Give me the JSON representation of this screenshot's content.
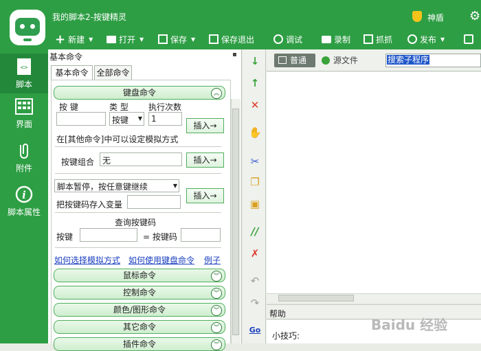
{
  "window": {
    "title": "我的脚本2-按键精灵",
    "vip_label": "神盾"
  },
  "toolbar": {
    "new": "新建",
    "open": "打开",
    "save": "保存",
    "save_exit": "保存退出",
    "debug": "调试",
    "record": "录制",
    "capture": "抓抓",
    "publish": "发布"
  },
  "sidebar": {
    "items": [
      {
        "label": "脚本",
        "icon": "script-icon"
      },
      {
        "label": "界面",
        "icon": "interface-icon"
      },
      {
        "label": "附件",
        "icon": "attachment-icon"
      },
      {
        "label": "脚本属性",
        "icon": "info-icon"
      }
    ]
  },
  "panel": {
    "title": "基本命令",
    "tabs": {
      "basic": "基本命令",
      "all": "全部命令"
    },
    "keyboard": {
      "header": "键盘命令",
      "key_label": "按 键",
      "type_label": "类 型",
      "count_label": "执行次数",
      "type_value": "按键",
      "count_value": "1",
      "insert": "插入→",
      "hint": "在[其他命令]中可以设定模拟方式",
      "combo_label": "按键组合",
      "combo_value": "无",
      "pause_select": "脚本暂停，按任意键继续",
      "store_label": "把按键码存入变量",
      "query_title": "查询按键码",
      "query_key_label": "按键",
      "query_code_label": "= 按键码",
      "link_simulation": "如何选择模拟方式",
      "link_usage": "如何使用键盘命令",
      "link_example": "例子"
    },
    "groups": [
      "鼠标命令",
      "控制命令",
      "颜色/图形命令",
      "其它命令",
      "插件命令"
    ]
  },
  "editor": {
    "normal_tab": "普通",
    "source_tab": "源文件",
    "search_placeholder": "搜索子程序",
    "help_label": "帮助",
    "tip_label": "小技巧:"
  },
  "watermark": "Baidu 经验",
  "colors": {
    "accent": "#2e9e44",
    "accent_dark": "#23883a",
    "selection": "#1e55c8"
  }
}
